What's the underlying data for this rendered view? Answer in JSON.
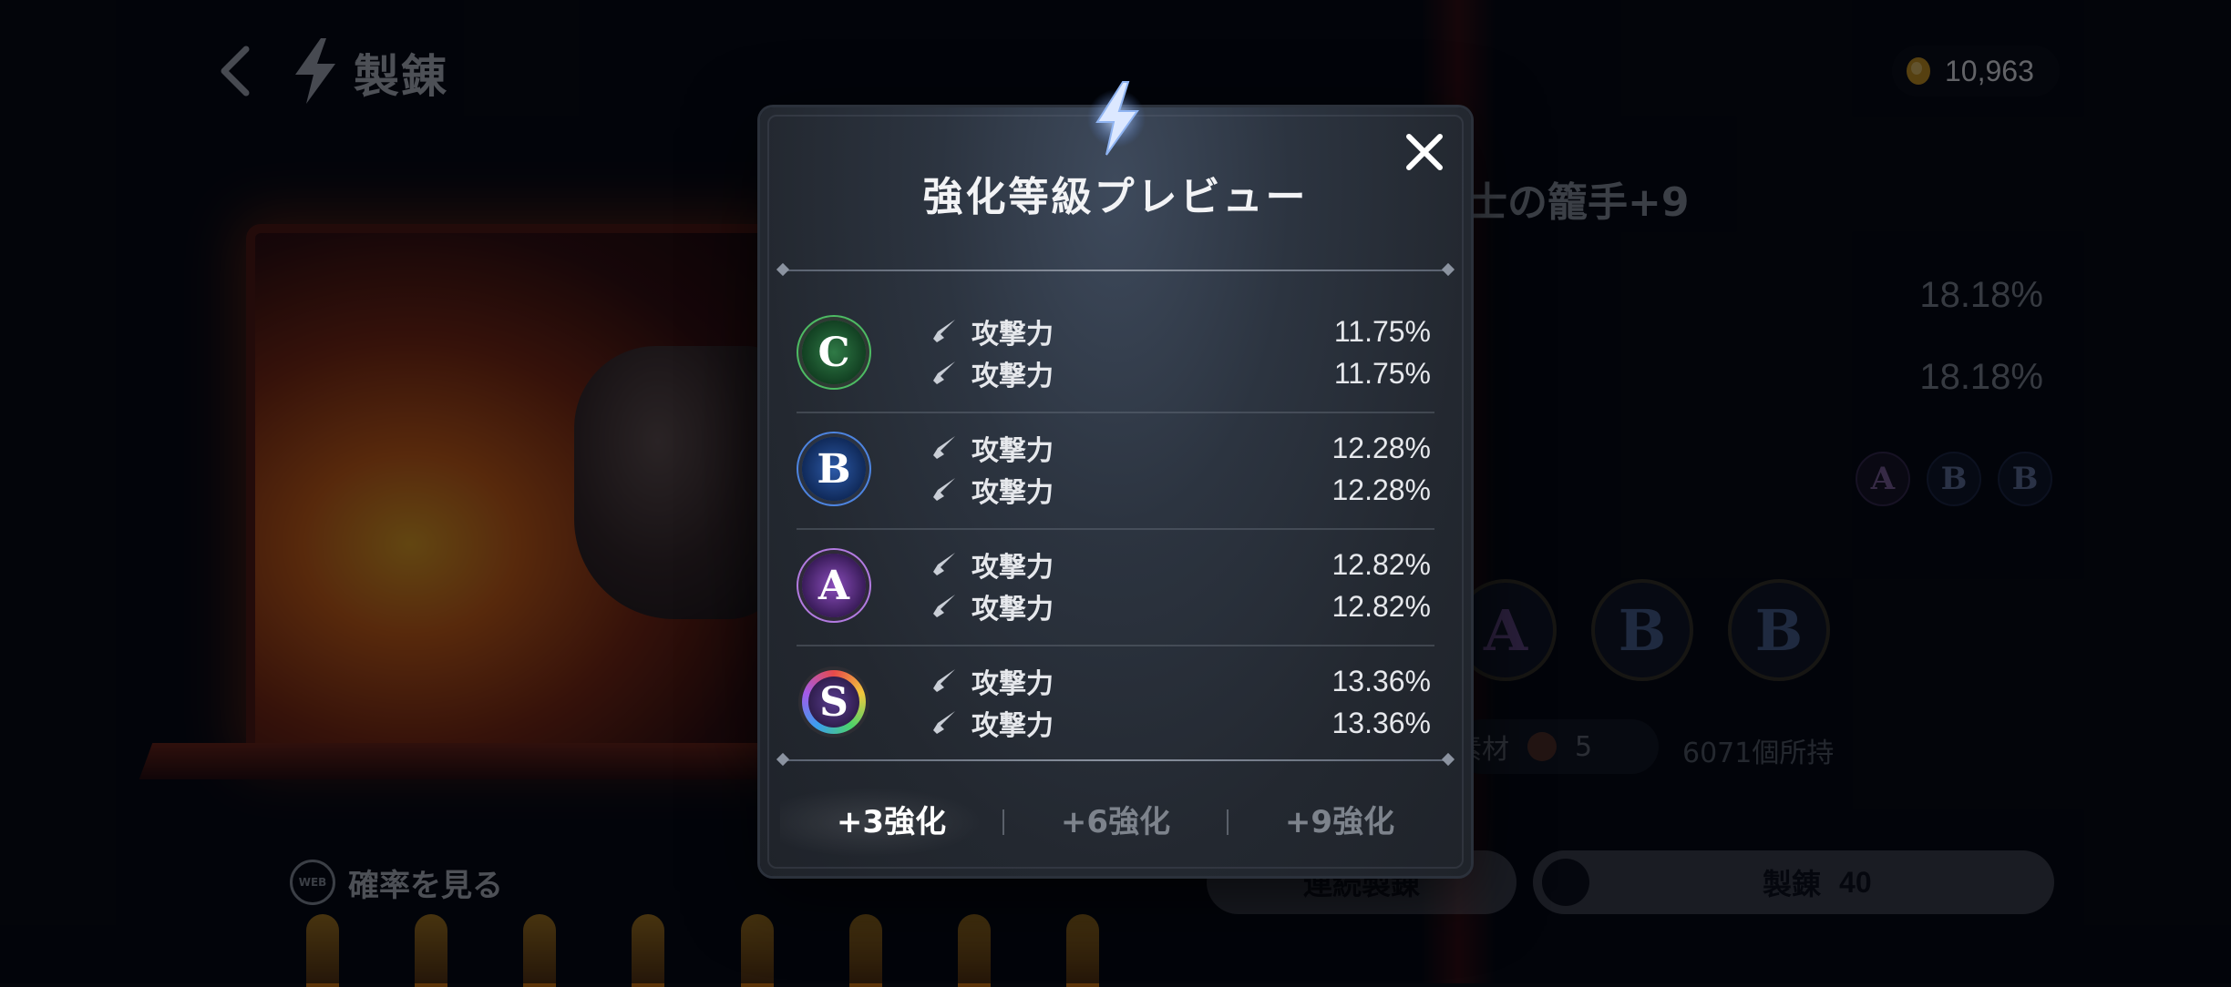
{
  "header": {
    "title": "製錬"
  },
  "currency": {
    "amount": "10,963"
  },
  "background": {
    "item_name": "士の籠手+9",
    "stat_percents": [
      "18.18%",
      "18.18%"
    ],
    "mini_grades": [
      "A",
      "B",
      "B"
    ],
    "big_grades": [
      "A",
      "B",
      "B"
    ],
    "material_label": "素材",
    "material_count": "5",
    "owned_text": "6071個所持",
    "probability_link": "確率を見る",
    "web_icon_text": "WEB",
    "continuous_button": "連続製錬",
    "refine_button": "製錬",
    "refine_cost": "40"
  },
  "modal": {
    "title": "強化等級プレビュー",
    "grades": [
      {
        "grade": "C",
        "color": "#4dbb63",
        "stats": [
          {
            "name": "攻撃力",
            "value": "11.75%"
          },
          {
            "name": "攻撃力",
            "value": "11.75%"
          }
        ]
      },
      {
        "grade": "B",
        "color": "#4d84e0",
        "stats": [
          {
            "name": "攻撃力",
            "value": "12.28%"
          },
          {
            "name": "攻撃力",
            "value": "12.28%"
          }
        ]
      },
      {
        "grade": "A",
        "color": "#b27ae0",
        "stats": [
          {
            "name": "攻撃力",
            "value": "12.82%"
          },
          {
            "name": "攻撃力",
            "value": "12.82%"
          }
        ]
      },
      {
        "grade": "S",
        "color": "rainbow",
        "stats": [
          {
            "name": "攻撃力",
            "value": "13.36%"
          },
          {
            "name": "攻撃力",
            "value": "13.36%"
          }
        ]
      }
    ],
    "tabs": [
      {
        "label": "+3強化",
        "active": true
      },
      {
        "label": "+6強化",
        "active": false
      },
      {
        "label": "+9強化",
        "active": false
      }
    ]
  },
  "icons": [
    "back-arrow-icon",
    "lightning-bolt-icon",
    "coin-icon",
    "close-icon",
    "sword-icon",
    "web-icon"
  ]
}
